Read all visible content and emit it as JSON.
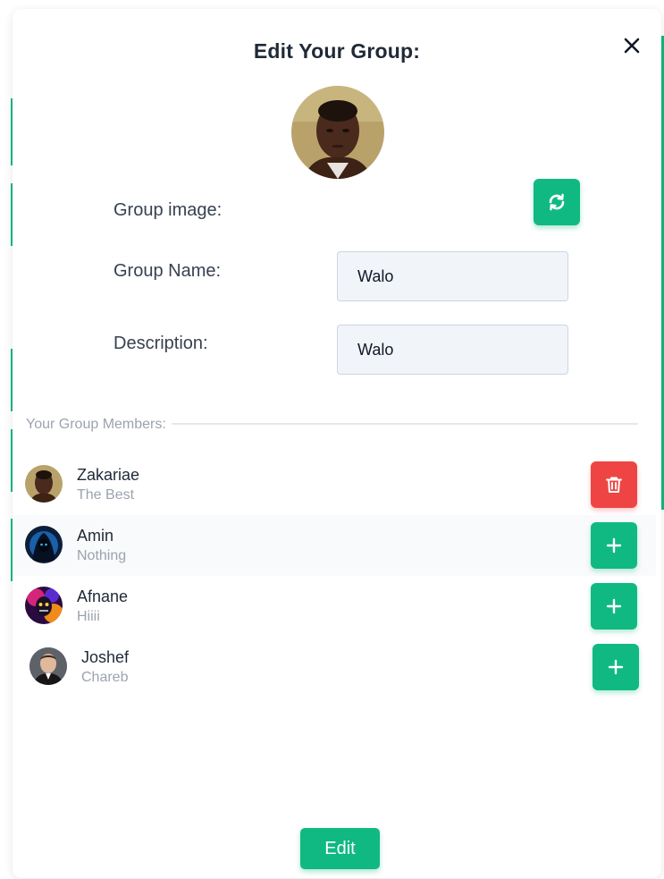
{
  "modal": {
    "title": "Edit Your Group:",
    "close_icon": "close-icon"
  },
  "form": {
    "image_label": "Group image:",
    "refresh_icon": "refresh-icon",
    "name_label": "Group Name:",
    "name_value": "Walo",
    "description_label": "Description:",
    "description_value": "Walo"
  },
  "members": {
    "section_title": "Your Group Members:",
    "items": [
      {
        "name": "Zakariae",
        "status": "The Best",
        "action": "remove",
        "action_icon": "trash-icon"
      },
      {
        "name": "Amin",
        "status": "Nothing",
        "action": "add",
        "action_icon": "plus-icon"
      },
      {
        "name": "Afnane",
        "status": "Hiiii",
        "action": "add",
        "action_icon": "plus-icon"
      },
      {
        "name": "Joshef",
        "status": "Chareb",
        "action": "add",
        "action_icon": "plus-icon"
      }
    ]
  },
  "footer": {
    "edit_label": "Edit"
  },
  "colors": {
    "accent": "#10b981",
    "danger": "#ef4444",
    "text": "#1f2937",
    "muted": "#9ca3af"
  }
}
